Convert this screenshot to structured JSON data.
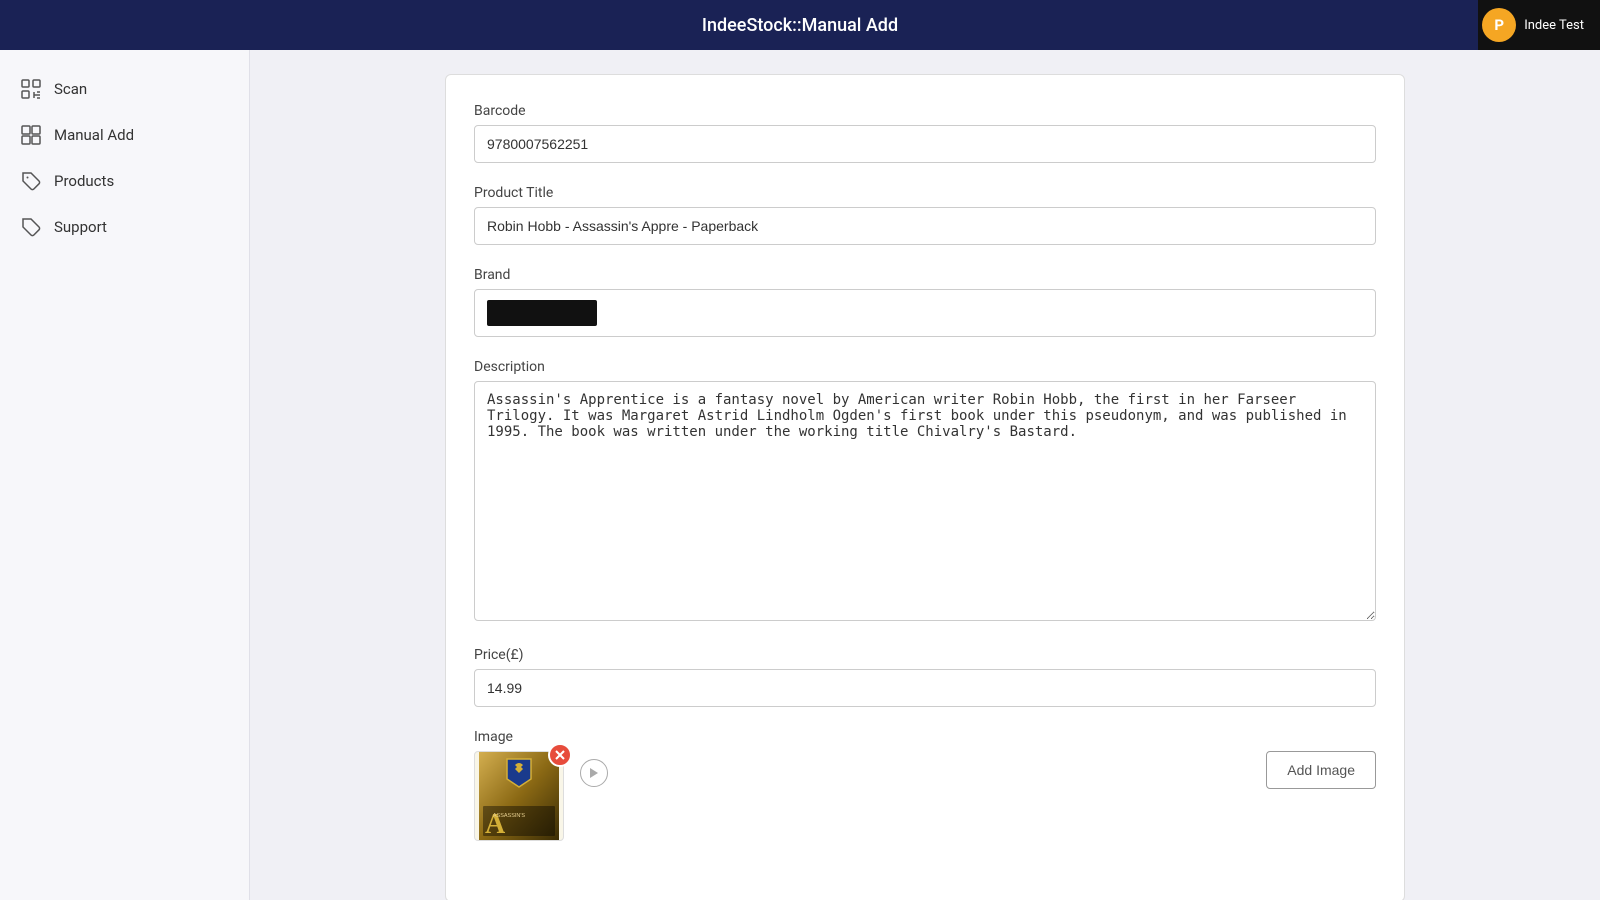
{
  "header": {
    "title": "IndeeStock::Manual Add",
    "user": {
      "initial": "P",
      "name": "Indee Test"
    }
  },
  "sidebar": {
    "items": [
      {
        "id": "scan",
        "label": "Scan",
        "icon": "scan-icon"
      },
      {
        "id": "manual-add",
        "label": "Manual Add",
        "icon": "grid-icon"
      },
      {
        "id": "products",
        "label": "Products",
        "icon": "tag-icon"
      },
      {
        "id": "support",
        "label": "Support",
        "icon": "support-icon"
      }
    ]
  },
  "form": {
    "barcode_label": "Barcode",
    "barcode_value": "9780007562251",
    "product_title_label": "Product Title",
    "product_title_value": "Robin Hobb - Assassin's Appre - Paperback",
    "brand_label": "Brand",
    "brand_value": "",
    "description_label": "Description",
    "description_value": "Assassin's Apprentice is a fantasy novel by American writer Robin Hobb, the first in her Farseer Trilogy. It was Margaret Astrid Lindholm Ogden's first book under this pseudonym, and was published in 1995. The book was written under the working title Chivalry's Bastard.",
    "price_label": "Price(£)",
    "price_value": "14.99",
    "image_label": "Image",
    "add_image_button": "Add Image"
  }
}
